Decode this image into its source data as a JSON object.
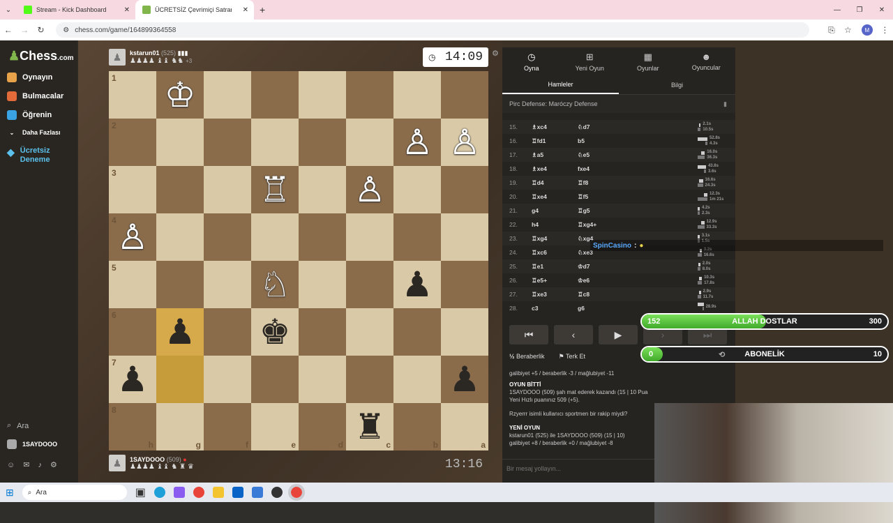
{
  "tabs": [
    {
      "label": "Stream - Kick Dashboard"
    },
    {
      "label": "ÜCRETSİZ Çevrimiçi Satranç Oy"
    }
  ],
  "new_tab": "+",
  "address": {
    "url": "chess.com/game/164899364558",
    "profile": "M"
  },
  "sidebar": {
    "logo_main": "Chess",
    "logo_suffix": ".com",
    "items": [
      {
        "label": "Oynayın"
      },
      {
        "label": "Bulmacalar"
      },
      {
        "label": "Öğrenin"
      },
      {
        "label": "Daha Fazlası"
      },
      {
        "label": "Ücretsiz Deneme"
      }
    ],
    "search": "Ara",
    "user": "1SAYDOOO"
  },
  "top_player": {
    "name": "kstarun01",
    "rating": "(525)",
    "extra": "+3",
    "captured": "♟♟♟♟ ♝♝ ♞♞"
  },
  "bottom_player": {
    "name": "1SAYDOOO",
    "rating": "(509)",
    "captured": "♟♟♟♟ ♝♝ ♞ ♜ ♛"
  },
  "clocks": {
    "top": "14:09",
    "bottom": "13:16"
  },
  "board": {
    "ranks": [
      "1",
      "2",
      "3",
      "4",
      "5",
      "6",
      "7",
      "8"
    ],
    "files": [
      "h",
      "g",
      "f",
      "e",
      "d",
      "c",
      "b",
      "a"
    ]
  },
  "panel": {
    "tabs": [
      {
        "label": "Oyna",
        "icon": "clock-icon"
      },
      {
        "label": "Yeni Oyun",
        "icon": "plus-icon"
      },
      {
        "label": "Oyunlar",
        "icon": "board-icon"
      },
      {
        "label": "Oyuncular",
        "icon": "players-icon"
      }
    ],
    "subtabs": [
      "Hamleler",
      "Bilgi"
    ],
    "opening": "Pirc Defense: Maróczy Defense",
    "moves": [
      {
        "n": "15.",
        "w": "♗xc4",
        "b": "♘d7",
        "tw": "2.1s",
        "tb": "10.5s",
        "fw": 0.04,
        "fb": 0.2
      },
      {
        "n": "16.",
        "w": "♖fd1",
        "b": "b5",
        "tw": "52.8s",
        "tb": "4.3s",
        "fw": 1,
        "fb": 0.08
      },
      {
        "n": "17.",
        "w": "♗a5",
        "b": "♘e5",
        "tw": "16.0s",
        "tb": "36.3s",
        "fw": 0.3,
        "fb": 0.69
      },
      {
        "n": "18.",
        "w": "♗xe4",
        "b": "fxe4",
        "tw": "43.8s",
        "tb": "3.6s",
        "fw": 0.83,
        "fb": 0.07
      },
      {
        "n": "19.",
        "w": "♖d4",
        "b": "♖f8",
        "tw": "16.6s",
        "tb": "24.3s",
        "fw": 0.31,
        "fb": 0.46
      },
      {
        "n": "20.",
        "w": "♖xe4",
        "b": "♖f5",
        "tw": "12.3s",
        "tb": "1m 21s",
        "fw": 0.23,
        "fb": 1
      },
      {
        "n": "21.",
        "w": "g4",
        "b": "♖g5",
        "tw": "4.2s",
        "tb": "2.3s",
        "fw": 0.08,
        "fb": 0.04
      },
      {
        "n": "22.",
        "w": "h4",
        "b": "♖xg4+",
        "tw": "12.9s",
        "tb": "33.3s",
        "fw": 0.24,
        "fb": 0.63
      },
      {
        "n": "23.",
        "w": "♖xg4",
        "b": "♘xg4",
        "tw": "3.1s",
        "tb": "1.5s",
        "fw": 0.06,
        "fb": 0.03
      },
      {
        "n": "24.",
        "w": "♖xc6",
        "b": "♘xe3",
        "tw": "3.2s",
        "tb": "16.6s",
        "fw": 0.06,
        "fb": 0.31
      },
      {
        "n": "25.",
        "w": "♖e1",
        "b": "♔d7",
        "tw": "2.0s",
        "tb": "8.0s",
        "fw": 0.04,
        "fb": 0.15
      },
      {
        "n": "26.",
        "w": "♖e5+",
        "b": "♔e6",
        "tw": "10.3s",
        "tb": "17.8s",
        "fw": 0.2,
        "fb": 0.34
      },
      {
        "n": "27.",
        "w": "♖xe3",
        "b": "♖c8",
        "tw": "2.9s",
        "tb": "11.7s",
        "fw": 0.05,
        "fb": 0.22
      },
      {
        "n": "28.",
        "w": "c3",
        "b": "g6",
        "tw": "28.9s",
        "tb": "",
        "fw": 0.55,
        "fb": 0
      }
    ],
    "draw": "Beraberlik",
    "resign": "Terk Et",
    "chat": {
      "line1": "galibiyet +5 / beraberlik -3 / mağlubiyet -11",
      "over_title": "OYUN BİTTİ",
      "over_text": "1SAYDOOO (509) şah mat ederek kazandı (15 | 10 Pua",
      "over_text2": "Yeni Hızlı puanınız 509 (+5).",
      "question": "Rzyerrr isimli kullanıcı sportmen bir rakip miydi?",
      "new_title": "YENİ OYUN",
      "new_text": "kstarun01 (525) ile 1SAYDOOO (509) (15 | 10)",
      "new_text2": "galibiyet +8 / beraberlik +0 / mağlubiyet -8",
      "placeholder": "Bir mesaj yollayın..."
    }
  },
  "overlay": {
    "chat_user": "SpinCasino",
    "goal1": {
      "current": "152",
      "label": "ALLAH DOSTLAR",
      "target": "300",
      "progress": 0.507
    },
    "goal2": {
      "current": "0",
      "label": "ABONELİK",
      "target": "10",
      "progress": 0
    }
  },
  "taskbar": {
    "search": "Ara"
  },
  "colors": {
    "accent": "#81b64c",
    "light_square": "#d9c9a6",
    "dark_square": "#8a6c4b",
    "highlight": "#d6a94a",
    "goal_green": "#5fcf3a"
  }
}
